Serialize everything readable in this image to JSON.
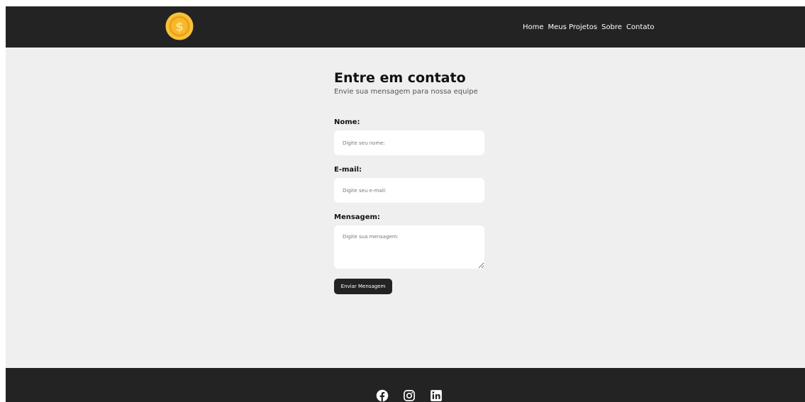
{
  "header": {
    "logo_icon": "coin-dollar-icon",
    "nav": [
      "Home",
      "Meus Projetos",
      "Sobre",
      "Contato"
    ]
  },
  "contact": {
    "title": "Entre em contato",
    "subtitle": "Envie sua mensagem para nossa equipe",
    "name_label": "Nome:",
    "name_placeholder": "Digite seu nome:",
    "email_label": "E-mail:",
    "email_placeholder": "Digite seu e-mail:",
    "message_label": "Mensagem:",
    "message_placeholder": "Digite sua mensagem:",
    "submit_label": "Enviar Mensagem"
  },
  "footer": {
    "social_icons": [
      "facebook-icon",
      "instagram-icon",
      "linkedin-icon"
    ]
  },
  "colors": {
    "dark": "#232323",
    "background": "#efefef",
    "coin_gold": "#f5b21e"
  }
}
